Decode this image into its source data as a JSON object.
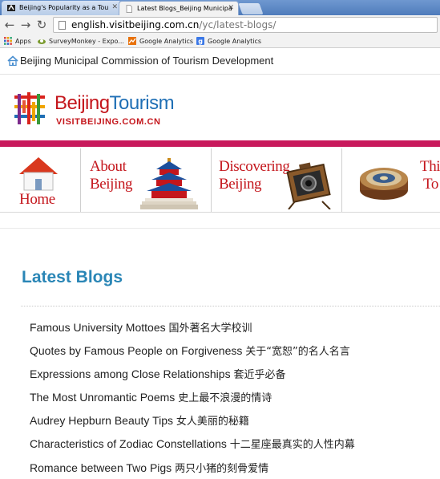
{
  "browser": {
    "tabs": [
      {
        "title": "Beijing's Popularity as a Tou",
        "active": false
      },
      {
        "title": "Latest Blogs_Beijing Municipa",
        "active": true
      }
    ],
    "url_host": "english.visitbeijing.com.cn",
    "url_path": "/yc/latest-blogs/",
    "bookmarks": [
      {
        "label": "Apps",
        "icon": "apps-grid-icon"
      },
      {
        "label": "SurveyMonkey - Expo...",
        "icon": "surveymonkey-icon"
      },
      {
        "label": "Google Analytics",
        "icon": "google-analytics-icon"
      },
      {
        "label": "Google Analytics",
        "icon": "google-icon"
      }
    ]
  },
  "page": {
    "commission": "Beijing Municipal Commission of Tourism Development",
    "logo": {
      "word1": "Beijing",
      "word2": "Tourism",
      "sub": "VISITBEIJING.COM.CN"
    },
    "nav": [
      {
        "line1": "Home",
        "line2": ""
      },
      {
        "line1": "About",
        "line2": "Beijing"
      },
      {
        "line1": "Discovering",
        "line2": "Beijing"
      },
      {
        "line1": "Thi",
        "line2": "To"
      }
    ],
    "heading": "Latest Blogs",
    "blogs": [
      {
        "en": "Famous University Mottoes",
        "zh": "国外著名大学校训"
      },
      {
        "en": "Quotes by Famous People on Forgiveness",
        "zh": "关于“宽恕”的名人名言"
      },
      {
        "en": "Expressions among Close Relationships",
        "zh": "套近乎必备"
      },
      {
        "en": "The Most Unromantic Poems",
        "zh": "史上最不浪漫的情诗"
      },
      {
        "en": "Audrey Hepburn Beauty Tips",
        "zh": "女人美丽的秘籍"
      },
      {
        "en": "Characteristics of Zodiac Constellations",
        "zh": "十二星座最真实的人性内幕"
      },
      {
        "en": "Romance between Two Pigs",
        "zh": "两只小猪的刻骨爱情"
      }
    ],
    "colors": {
      "brand_red": "#c4161c",
      "brand_blue": "#1f6fb5",
      "heading_blue": "#2a86b6",
      "magenta_bar": "#c8195c"
    }
  }
}
